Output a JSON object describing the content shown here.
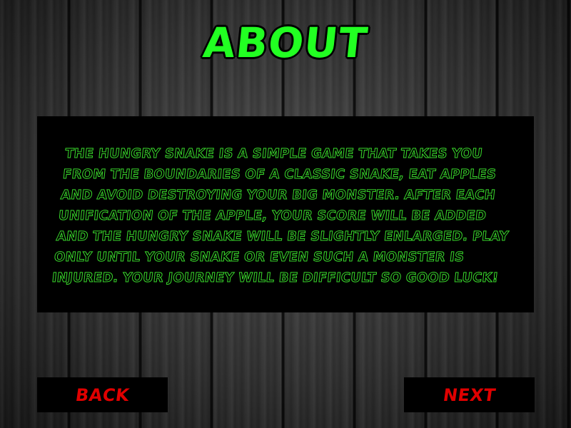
{
  "screen": {
    "title": "ABOUT",
    "description": "THE HUNGRY SNAKE IS A SIMPLE GAME THAT TAKES YOU FROM THE BOUNDARIES OF A CLASSIC SNAKE, EAT APPLES AND AVOID DESTROYING YOUR BIG MONSTER. AFTER EACH UNIFICATION OF THE APPLE, YOUR SCORE WILL BE ADDED AND THE HUNGRY SNAKE WILL BE SLIGHTLY ENLARGED. PLAY ONLY UNTIL YOUR SNAKE OR EVEN SUCH A MONSTER IS INJURED. YOUR JOURNEY WILL BE DIFFICULT SO GOOD LUCK!"
  },
  "buttons": {
    "back_label": "BACK",
    "next_label": "NEXT"
  },
  "colors": {
    "title": "#22ff22",
    "description": "#39d82b",
    "button_text": "#e00000",
    "panel": "#000000"
  }
}
